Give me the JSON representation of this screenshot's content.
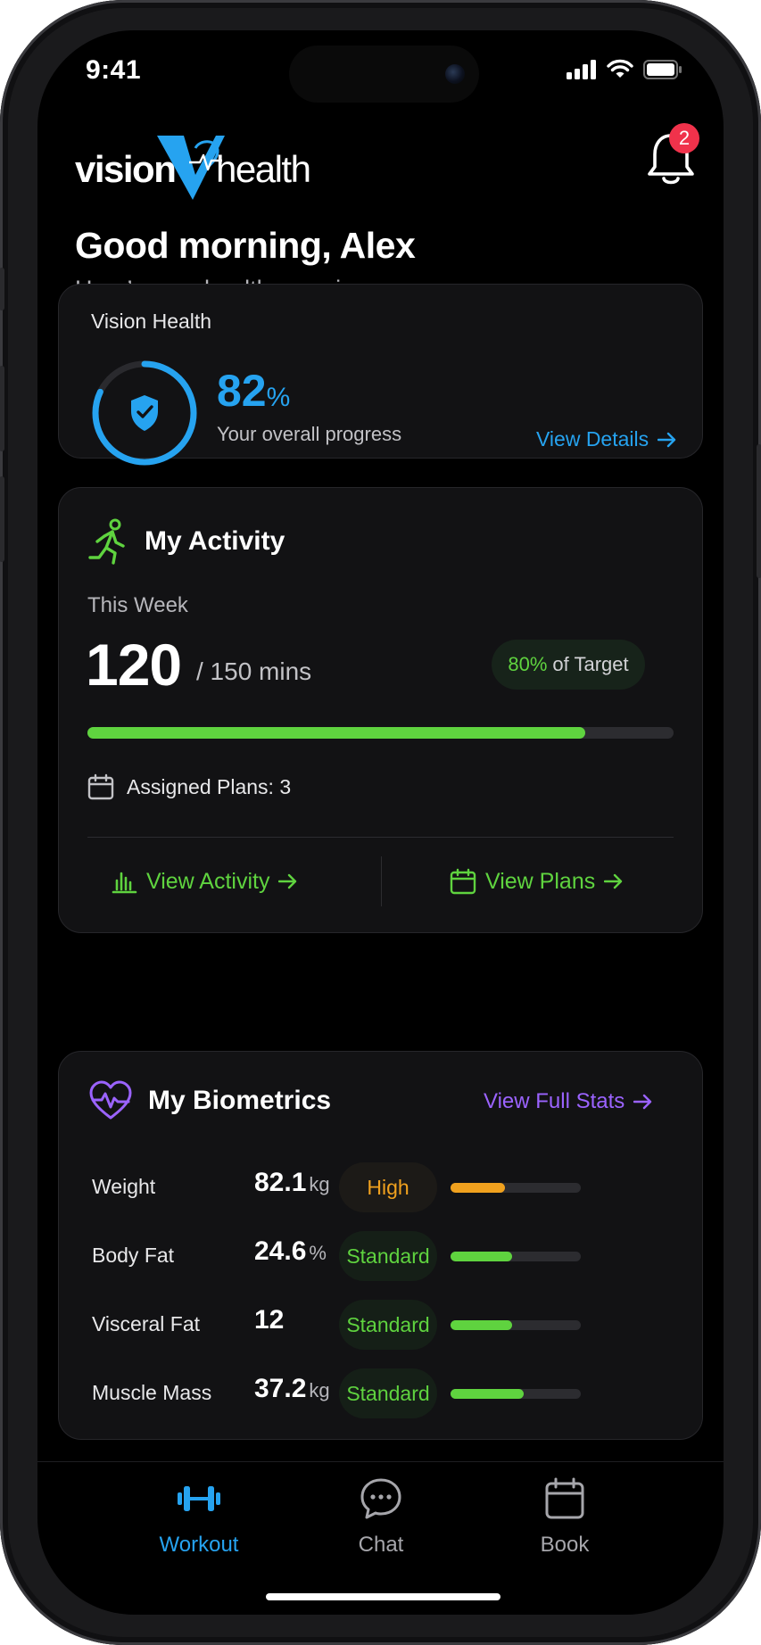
{
  "status_bar": {
    "time": "9:41"
  },
  "brand": {
    "word1": "vision",
    "word2": "health",
    "accent_color": "#26a3f0"
  },
  "notifications": {
    "count": "2"
  },
  "greeting": {
    "title": "Good morning, Alex",
    "subtitle": "Here’s your health overview"
  },
  "vision_health": {
    "title": "Vision Health",
    "percent_value": "82",
    "percent_sign": "%",
    "progress": 0.82,
    "description": "Your overall progress",
    "link_label": "View Details"
  },
  "activity": {
    "title": "My Activity",
    "period_label": "This Week",
    "current": "120",
    "target_label": "/ 150 mins",
    "target_percent": "80%",
    "target_suffix": "of Target",
    "progress": 0.85,
    "assigned_plans_label": "Assigned Plans: 3",
    "view_activity_label": "View Activity",
    "view_plans_label": "View Plans",
    "accent_color": "#5fd33f"
  },
  "biometrics": {
    "title": "My Biometrics",
    "link_label": "View Full Stats",
    "accent_color": "#9b63ff",
    "rows": [
      {
        "label": "Weight",
        "value": "82.1",
        "unit": "kg",
        "status": "High",
        "level": 0.42
      },
      {
        "label": "Body Fat",
        "value": "24.6",
        "unit": "%",
        "status": "Standard",
        "level": 0.47
      },
      {
        "label": "Visceral Fat",
        "value": "12",
        "unit": "",
        "status": "Standard",
        "level": 0.47
      },
      {
        "label": "Muscle Mass",
        "value": "37.2",
        "unit": "kg",
        "status": "Standard",
        "level": 0.56
      }
    ]
  },
  "bottom_nav": {
    "items": [
      {
        "label": "Workout",
        "icon": "dumbbell-icon",
        "active": true
      },
      {
        "label": "Chat",
        "icon": "chat-icon",
        "active": false
      },
      {
        "label": "Book",
        "icon": "calendar-icon",
        "active": false
      }
    ]
  }
}
